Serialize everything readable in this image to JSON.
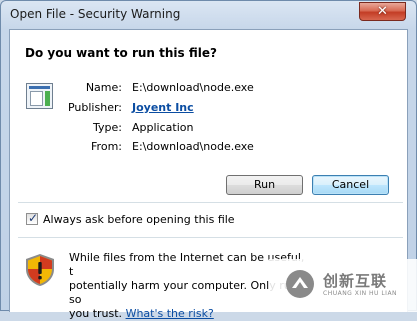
{
  "window": {
    "title": "Open File - Security Warning",
    "close_glyph": "✕"
  },
  "dialog": {
    "question": "Do you want to run this file?",
    "file_icon": "application-window-icon",
    "fields": [
      {
        "label": "Name:",
        "value": "E:\\download\\node.exe",
        "is_link": false
      },
      {
        "label": "Publisher:",
        "value": "Joyent Inc",
        "is_link": true
      },
      {
        "label": "Type:",
        "value": "Application",
        "is_link": false
      },
      {
        "label": "From:",
        "value": "E:\\download\\node.exe",
        "is_link": false
      }
    ],
    "buttons": {
      "run": "Run",
      "cancel": "Cancel"
    },
    "checkbox": {
      "label": "Always ask before opening this file",
      "checked": true,
      "glyph": "✓"
    },
    "warning": {
      "text": "While files from the Internet can be useful, this file type can potentially harm your computer. Only run software from publishers you trust.",
      "line1": "While files from the Internet can be useful, t",
      "line2": "potentially harm your computer. Only run so",
      "line3": "you trust.",
      "link": "What's the risk?"
    }
  },
  "watermark": {
    "cn": "创新互联",
    "en": "CHUANG XIN HU LIAN"
  },
  "colors": {
    "link": "#0b4da2",
    "close": "#c33d25",
    "shield_yellow": "#f2b705",
    "shield_red": "#d23b1f"
  }
}
